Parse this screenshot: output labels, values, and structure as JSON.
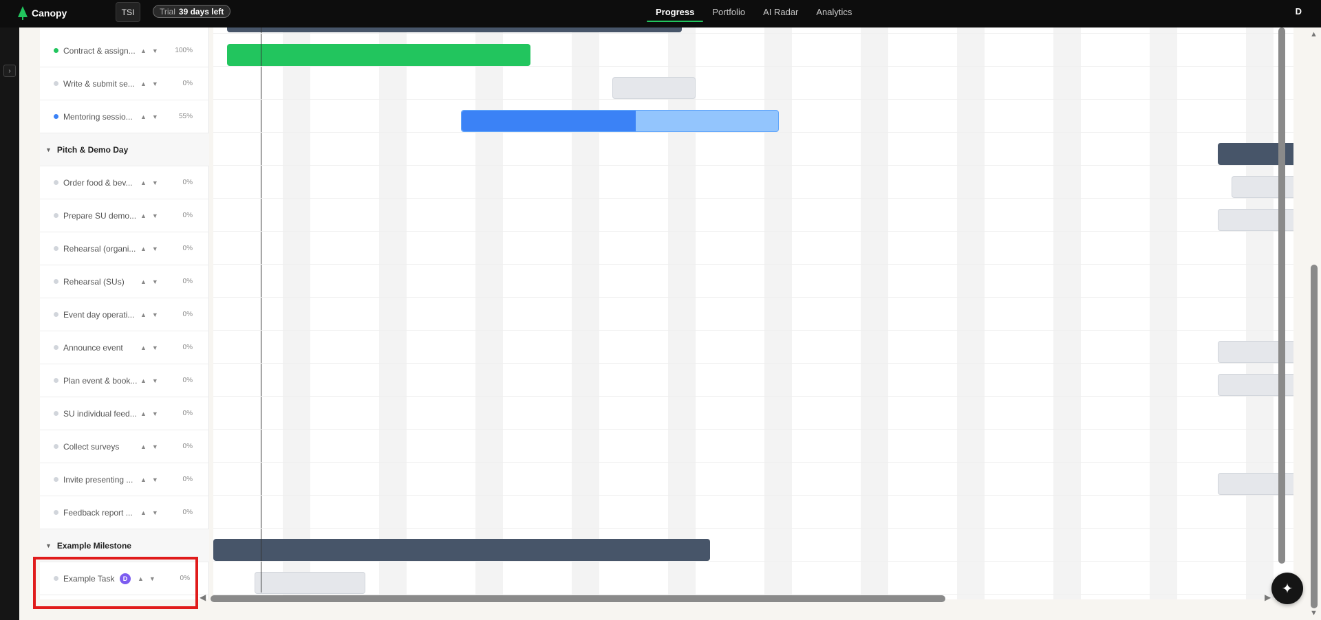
{
  "app": {
    "name": "Canopy",
    "workspace": "TSI",
    "trial_label": "Trial",
    "trial_days": "39 days left",
    "user_initial": "D"
  },
  "nav": {
    "tabs": [
      {
        "label": "Progress",
        "active": true
      },
      {
        "label": "Portfolio",
        "active": false
      },
      {
        "label": "AI Radar",
        "active": false
      },
      {
        "label": "Analytics",
        "active": false
      }
    ]
  },
  "colors": {
    "accent": "#22c55e",
    "milestone": "#475569",
    "progress_blue": "#3b82f6",
    "avatar": "#7c5cf0"
  },
  "rows": [
    {
      "type": "task",
      "name": "Contract & assign...",
      "status": "done",
      "dot": "#22c55e",
      "pct": "100%"
    },
    {
      "type": "task",
      "name": "Write & submit se...",
      "status": "todo",
      "dot": "#d1d5db",
      "pct": "0%"
    },
    {
      "type": "task",
      "name": "Mentoring sessio...",
      "status": "in-progress",
      "dot": "#3b82f6",
      "pct": "55%",
      "progress": 0.55
    },
    {
      "type": "group",
      "name": "Pitch & Demo Day"
    },
    {
      "type": "task",
      "name": "Order food & bev...",
      "status": "todo",
      "dot": "#d1d5db",
      "pct": "0%"
    },
    {
      "type": "task",
      "name": "Prepare SU demo...",
      "status": "todo",
      "dot": "#d1d5db",
      "pct": "0%"
    },
    {
      "type": "task",
      "name": "Rehearsal (organi...",
      "status": "todo",
      "dot": "#d1d5db",
      "pct": "0%"
    },
    {
      "type": "task",
      "name": "Rehearsal (SUs)",
      "status": "todo",
      "dot": "#d1d5db",
      "pct": "0%"
    },
    {
      "type": "task",
      "name": "Event day operati...",
      "status": "todo",
      "dot": "#d1d5db",
      "pct": "0%"
    },
    {
      "type": "task",
      "name": "Announce event",
      "status": "todo",
      "dot": "#d1d5db",
      "pct": "0%"
    },
    {
      "type": "task",
      "name": "Plan event & book...",
      "status": "todo",
      "dot": "#d1d5db",
      "pct": "0%"
    },
    {
      "type": "task",
      "name": "SU individual feed...",
      "status": "todo",
      "dot": "#d1d5db",
      "pct": "0%"
    },
    {
      "type": "task",
      "name": "Collect surveys",
      "status": "todo",
      "dot": "#d1d5db",
      "pct": "0%"
    },
    {
      "type": "task",
      "name": "Invite presenting ...",
      "status": "todo",
      "dot": "#d1d5db",
      "pct": "0%"
    },
    {
      "type": "task",
      "name": "Feedback report ...",
      "status": "todo",
      "dot": "#d1d5db",
      "pct": "0%"
    },
    {
      "type": "group",
      "name": "Example Milestone"
    },
    {
      "type": "task",
      "name": "Example Task",
      "status": "todo",
      "dot": "#d1d5db",
      "pct": "0%",
      "assignee": "D"
    }
  ],
  "icons": {
    "up": "▲",
    "down": "▼",
    "caret": "▼",
    "expand": "›",
    "ai": "✦",
    "scroll_left": "◀",
    "scroll_right": "▶",
    "scroll_up": "▲",
    "scroll_down": "▼"
  }
}
